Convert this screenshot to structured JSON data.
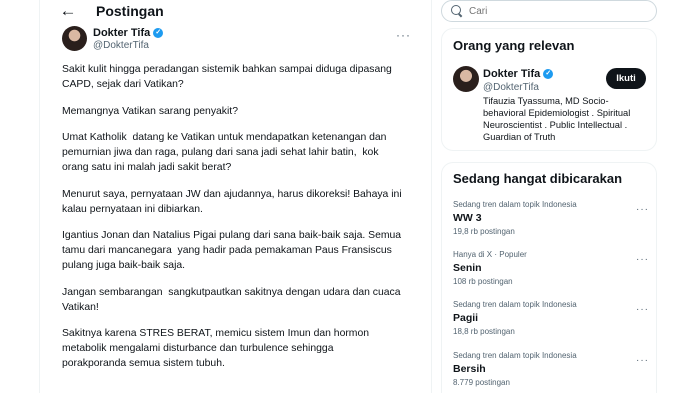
{
  "header": {
    "title": "Postingan",
    "back_icon": "arrow-left-icon"
  },
  "post": {
    "author_name": "Dokter Tifa",
    "author_handle": "@DokterTifa",
    "verified_icon": "verified-badge-icon",
    "more_icon": "more-horizontal-icon",
    "paragraphs": [
      "Sakit kulit hingga peradangan sistemik bahkan sampai diduga dipasang\nCAPD, sejak dari Vatikan?",
      "Memangnya Vatikan sarang penyakit?",
      "Umat Katholik  datang ke Vatikan untuk mendapatkan ketenangan dan\npemurnian jiwa dan raga, pulang dari sana jadi sehat lahir batin,  kok\norang satu ini malah jadi sakit berat?",
      "Menurut saya, pernyataan JW dan ajudannya, harus dikoreksi! Bahaya ini\nkalau pernyataan ini dibiarkan.",
      "Igantius Jonan dan Natalius Pigai pulang dari sana baik-baik saja. Semua\ntamu dari mancanegara  yang hadir pada pemakaman Paus Fransiscus\npulang juga baik-baik saja.",
      "Jangan sembarangan  sangkutpautkan sakitnya dengan udara dan cuaca\nVatikan!",
      "Sakitnya karena STRES BERAT, memicu sistem Imun dan hormon\nmetabolik mengalami disturbance dan turbulence sehingga\nporakporanda semua sistem tubuh."
    ]
  },
  "search": {
    "placeholder": "Cari",
    "icon": "search-icon"
  },
  "relevant": {
    "title": "Orang yang relevan",
    "name": "Dokter Tifa",
    "handle": "@DokterTifa",
    "follow_label": "Ikuti",
    "bio": "Tifauzia Tyassuma, MD Socio-behavioral Epidemiologist . Spiritual Neuroscientist . Public Intellectual . Guardian of Truth"
  },
  "trending": {
    "title": "Sedang hangat dibicarakan",
    "items": [
      {
        "meta": "Sedang tren dalam topik Indonesia",
        "topic": "WW 3",
        "count": "19,8 rb postingan"
      },
      {
        "meta": "Hanya di X · Populer",
        "topic": "Senin",
        "count": "108 rb postingan"
      },
      {
        "meta": "Sedang tren dalam topik Indonesia",
        "topic": "Pagii",
        "count": "18,8 rb postingan"
      },
      {
        "meta": "Sedang tren dalam topik Indonesia",
        "topic": "Bersih",
        "count": "8.779 postingan"
      }
    ]
  },
  "colors": {
    "accent": "#1d9bf0",
    "text": "#0f1419",
    "muted": "#536471",
    "border": "#eff3f4"
  }
}
